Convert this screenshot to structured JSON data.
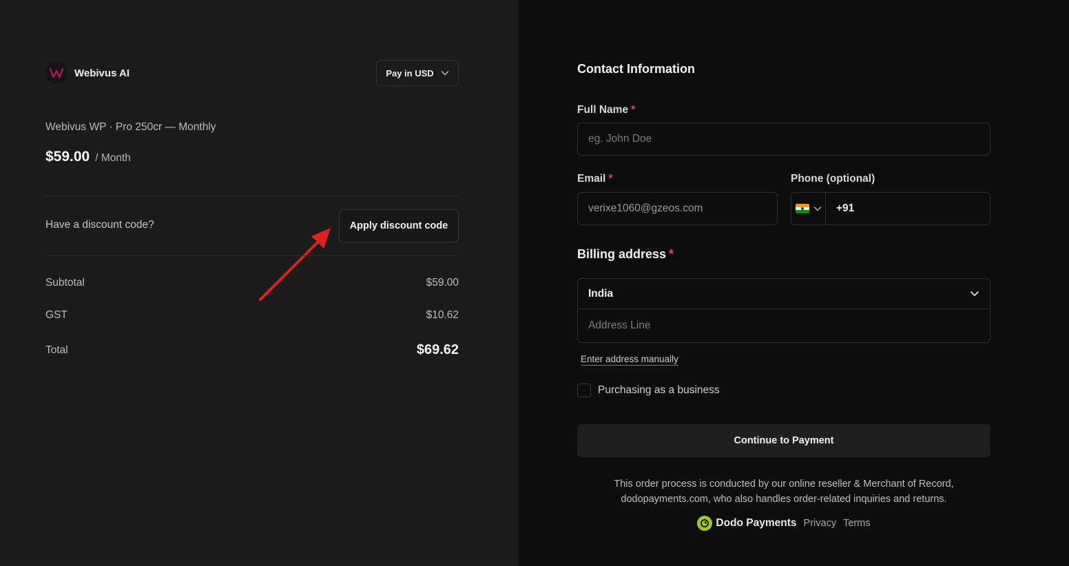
{
  "merchant": {
    "name": "Webivus AI"
  },
  "currency_selector": {
    "label": "Pay in USD"
  },
  "product": {
    "name": "Webivus WP · Pro 250cr — Monthly",
    "price": "$59.00",
    "period": "/ Month"
  },
  "discount": {
    "prompt": "Have a discount code?",
    "button_label": "Apply discount code"
  },
  "summary": {
    "subtotal_label": "Subtotal",
    "subtotal_value": "$59.00",
    "tax_label": "GST",
    "tax_value": "$10.62",
    "total_label": "Total",
    "total_value": "$69.62"
  },
  "contact": {
    "title": "Contact Information",
    "full_name_label": "Full Name",
    "full_name_placeholder": "eg. John Doe",
    "email_label": "Email",
    "email_value": "verixe1060@gzeos.com",
    "phone_label": "Phone (optional)",
    "phone_prefix": "+91",
    "phone_country_icon": "india-flag-icon",
    "required_mark": "*"
  },
  "billing": {
    "title": "Billing address",
    "country": "India",
    "address_placeholder": "Address Line",
    "manual_link": "Enter address manually",
    "business_label": "Purchasing as a business"
  },
  "payment": {
    "button_label": "Continue to Payment"
  },
  "footer": {
    "disclaimer_line1": "This order process is conducted by our online reseller & Merchant of Record,",
    "disclaimer_line2": "dodopayments.com, who also handles order-related inquiries and returns.",
    "brand": "Dodo Payments",
    "privacy": "Privacy",
    "terms": "Terms"
  },
  "colors": {
    "left_bg": "#1b1b1c",
    "right_bg": "#0d0d0d",
    "required": "#e5484d",
    "annotation_arrow": "#e0201c",
    "dodo_green": "#9cc92a"
  }
}
